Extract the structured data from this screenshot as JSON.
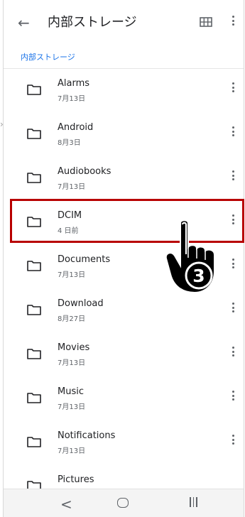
{
  "app_bar": {
    "back_glyph": "←",
    "title": "内部ストレージ"
  },
  "breadcrumb": "内部ストレージ",
  "folders": [
    {
      "name": "Alarms",
      "date": "7月13日"
    },
    {
      "name": "Android",
      "date": "8月3日"
    },
    {
      "name": "Audiobooks",
      "date": "7月13日"
    },
    {
      "name": "DCIM",
      "date": "4 日前"
    },
    {
      "name": "Documents",
      "date": "7月13日"
    },
    {
      "name": "Download",
      "date": "8月27日"
    },
    {
      "name": "Movies",
      "date": "7月13日"
    },
    {
      "name": "Music",
      "date": "7月13日"
    },
    {
      "name": "Notifications",
      "date": "7月13日"
    },
    {
      "name": "Pictures",
      "date": ""
    }
  ],
  "highlighted_folder": "DCIM",
  "step_badge": "3",
  "nav": {
    "back_glyph": "<"
  },
  "colors": {
    "accent": "#1a73e8",
    "highlight_border": "#b80000",
    "icon": "#5f6368"
  },
  "icons": [
    "back-arrow-icon",
    "grid-view-icon",
    "more-vert-icon",
    "folder-icon",
    "pointing-hand-icon",
    "home-icon",
    "recent-apps-icon"
  ]
}
